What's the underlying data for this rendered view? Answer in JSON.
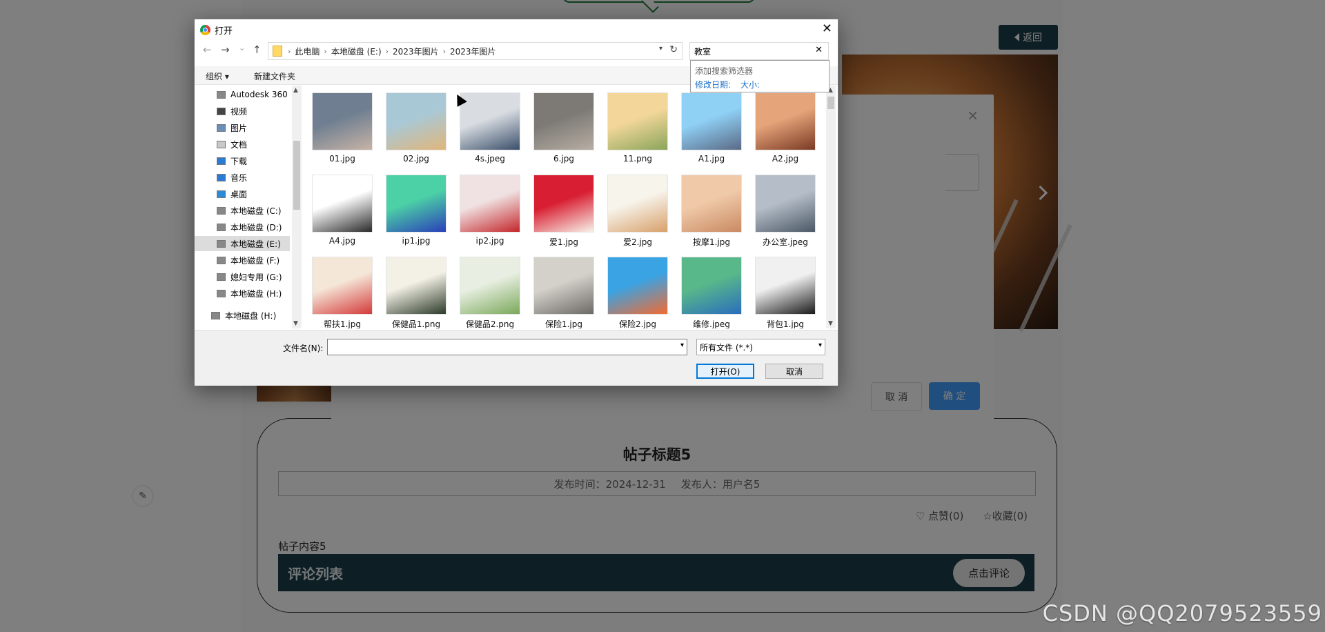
{
  "background": {
    "back_button": "返回",
    "post": {
      "title": "帖子标题5",
      "publish_time_label": "发布时间：2024-12-31",
      "publisher_label": "发布人：用户名5",
      "like": "点赞(0)",
      "favorite": "收藏(0)",
      "content": "帖子内容5",
      "comment_list_title": "评论列表",
      "comment_button": "点击评论"
    },
    "modal": {
      "close": "×",
      "cancel": "取 消",
      "confirm": "确 定"
    },
    "watermark": "CSDN @QQ2079523559"
  },
  "dialog": {
    "title": "打开",
    "close": "✕",
    "nav": {
      "back": "←",
      "forward": "→",
      "recent": "⌄",
      "up": "↑"
    },
    "breadcrumbs": [
      "此电脑",
      "本地磁盘 (E:)",
      "2023年图片",
      "2023年图片"
    ],
    "search_value": "教室",
    "search_clear": "✕",
    "suggest": {
      "title": "添加搜索筛选器",
      "filter_date": "修改日期:",
      "filter_size": "大小:"
    },
    "toolbar": {
      "organize": "组织 ▾",
      "new_folder": "新建文件夹"
    },
    "tree": [
      {
        "label": "Autodesk 360",
        "icon": "cloud-icon",
        "color": "#888888"
      },
      {
        "label": "视频",
        "icon": "video-icon",
        "color": "#444444"
      },
      {
        "label": "图片",
        "icon": "pictures-icon",
        "color": "#6a8fb8"
      },
      {
        "label": "文档",
        "icon": "documents-icon",
        "color": "#c9c9c9"
      },
      {
        "label": "下载",
        "icon": "download-icon",
        "color": "#2b7bd4"
      },
      {
        "label": "音乐",
        "icon": "music-icon",
        "color": "#2b7bd4"
      },
      {
        "label": "桌面",
        "icon": "desktop-icon",
        "color": "#2b8bd8"
      },
      {
        "label": "本地磁盘 (C:)",
        "icon": "drive-icon",
        "color": "#888888"
      },
      {
        "label": "本地磁盘 (D:)",
        "icon": "drive-icon",
        "color": "#888888"
      },
      {
        "label": "本地磁盘 (E:)",
        "icon": "drive-icon",
        "color": "#888888",
        "selected": true
      },
      {
        "label": "本地磁盘 (F:)",
        "icon": "drive-icon",
        "color": "#888888"
      },
      {
        "label": "媳妇专用 (G:)",
        "icon": "drive-icon",
        "color": "#888888"
      },
      {
        "label": "本地磁盘 (H:)",
        "icon": "drive-icon",
        "color": "#888888"
      },
      {
        "label": "本地磁盘 (H:)",
        "icon": "drive-icon",
        "color": "#888888",
        "root": true
      }
    ],
    "files": [
      {
        "name": "01.jpg",
        "colors": [
          "#6f7f91",
          "#c7b3a6"
        ]
      },
      {
        "name": "02.jpg",
        "colors": [
          "#a9c8d6",
          "#e0b67a"
        ]
      },
      {
        "name": "4s.jpeg",
        "colors": [
          "#d9dde2",
          "#3a4f6a"
        ]
      },
      {
        "name": "6.jpg",
        "colors": [
          "#7d7a76",
          "#b7aea3"
        ]
      },
      {
        "name": "11.png",
        "colors": [
          "#f3d79a",
          "#8aa55a"
        ]
      },
      {
        "name": "A1.jpg",
        "colors": [
          "#8fd0f5",
          "#5a6a86"
        ]
      },
      {
        "name": "A2.jpg",
        "colors": [
          "#e6a47a",
          "#7a3a24"
        ]
      },
      {
        "name": "A4.jpg",
        "colors": [
          "#ffffff",
          "#2b2b2b"
        ]
      },
      {
        "name": "ip1.jpg",
        "colors": [
          "#4cd0a6",
          "#2a3fb8"
        ]
      },
      {
        "name": "ip2.jpg",
        "colors": [
          "#f0e2e2",
          "#c4262b"
        ]
      },
      {
        "name": "爱1.jpg",
        "colors": [
          "#d81e32",
          "#f7f2e8"
        ]
      },
      {
        "name": "爱2.jpg",
        "colors": [
          "#f7f4ec",
          "#d8a06a"
        ]
      },
      {
        "name": "按摩1.jpg",
        "colors": [
          "#f0c9a8",
          "#c98a62"
        ]
      },
      {
        "name": "办公室.jpeg",
        "colors": [
          "#b5bec8",
          "#4c5866"
        ]
      },
      {
        "name": "帮扶1.jpg",
        "colors": [
          "#f5e7d8",
          "#d43a3a"
        ]
      },
      {
        "name": "保健品1.png",
        "colors": [
          "#f3f0e6",
          "#2c3b2a"
        ]
      },
      {
        "name": "保健品2.png",
        "colors": [
          "#e8efe2",
          "#7aa85a"
        ]
      },
      {
        "name": "保险1.jpg",
        "colors": [
          "#d4d1cb",
          "#6c6a66"
        ]
      },
      {
        "name": "保险2.jpg",
        "colors": [
          "#3aa3e3",
          "#f26b32"
        ]
      },
      {
        "name": "维修.jpeg",
        "colors": [
          "#58b88a",
          "#2a6dbc"
        ]
      },
      {
        "name": "背包1.jpg",
        "colors": [
          "#f0f0f0",
          "#1a1a1a"
        ]
      }
    ],
    "filename_label": "文件名(N):",
    "filename_value": "",
    "filetype_value": "所有文件 (*.*)",
    "open_button": "打开(O)",
    "cancel_button": "取消"
  }
}
